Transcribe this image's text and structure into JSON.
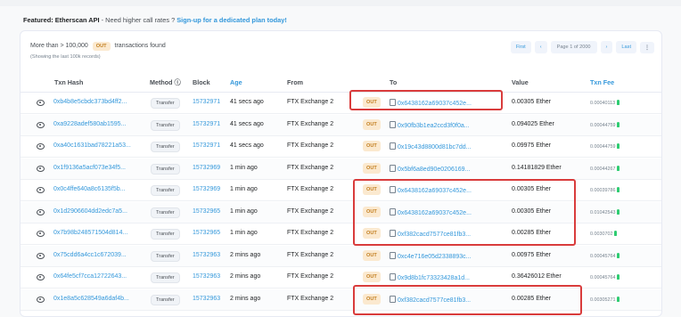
{
  "featured": {
    "label": "Featured: Etherscan API",
    "text": " - Need higher call rates ? ",
    "link": "Sign-up for a dedicated plan today!"
  },
  "summary": {
    "prefix": "More than > 100,000",
    "badge": "OUT",
    "suffix": "transactions found",
    "sub": "(Showing the last 100k records)"
  },
  "pager": {
    "first": "First",
    "prev": "‹",
    "page": "Page 1 of 2000",
    "next": "›",
    "last": "Last",
    "more": "⋮"
  },
  "columns": {
    "txn_hash": "Txn Hash",
    "method": "Method ⓘ",
    "block": "Block",
    "age": "Age",
    "from": "From",
    "to": "To",
    "value": "Value",
    "fee": "Txn Fee"
  },
  "rows": [
    {
      "hash": "0xb4b8e5cbdc373bd4ff2...",
      "method": "Transfer",
      "block": "15732971",
      "age": "41 secs ago",
      "from": "FTX Exchange 2",
      "dir": "OUT",
      "to": "0x6438162a69037c452e...",
      "value": "0.00305 Ether",
      "fee": "0.00040113"
    },
    {
      "hash": "0xa9228adef580ab1595...",
      "method": "Transfer",
      "block": "15732971",
      "age": "41 secs ago",
      "from": "FTX Exchange 2",
      "dir": "OUT",
      "to": "0x90fb3b1ea2ccd3f0f0a...",
      "value": "0.094025 Ether",
      "fee": "0.00044759"
    },
    {
      "hash": "0xa40c1631bad78221a53...",
      "method": "Transfer",
      "block": "15732971",
      "age": "41 secs ago",
      "from": "FTX Exchange 2",
      "dir": "OUT",
      "to": "0x19c43d8800d81bc7dd...",
      "value": "0.09975 Ether",
      "fee": "0.00044759"
    },
    {
      "hash": "0x1f9136a5acf073e34f5...",
      "method": "Transfer",
      "block": "15732969",
      "age": "1 min ago",
      "from": "FTX Exchange 2",
      "dir": "OUT",
      "to": "0x5bf6a8ed90e0206169...",
      "value": "0.14181829 Ether",
      "fee": "0.00044267"
    },
    {
      "hash": "0x0c4ffe640a8c6135f5b...",
      "method": "Transfer",
      "block": "15732969",
      "age": "1 min ago",
      "from": "FTX Exchange 2",
      "dir": "OUT",
      "to": "0x6438162a69037c452e...",
      "value": "0.00305 Ether",
      "fee": "0.00039786"
    },
    {
      "hash": "0x1d2906604dd2edc7a5...",
      "method": "Transfer",
      "block": "15732965",
      "age": "1 min ago",
      "from": "FTX Exchange 2",
      "dir": "OUT",
      "to": "0x6438162a69037c452e...",
      "value": "0.00305 Ether",
      "fee": "0.01042543"
    },
    {
      "hash": "0x7b98b248571504d814...",
      "method": "Transfer",
      "block": "15732965",
      "age": "1 min ago",
      "from": "FTX Exchange 2",
      "dir": "OUT",
      "to": "0xf382cacd7577ce81fb3...",
      "value": "0.00285 Ether",
      "fee": "0.0030702"
    },
    {
      "hash": "0x75cdd6a4cc1c672039...",
      "method": "Transfer",
      "block": "15732963",
      "age": "2 mins ago",
      "from": "FTX Exchange 2",
      "dir": "OUT",
      "to": "0xc4e716e05d2338893c...",
      "value": "0.00975 Ether",
      "fee": "0.00045764"
    },
    {
      "hash": "0x64fe5cf7cca12722643...",
      "method": "Transfer",
      "block": "15732963",
      "age": "2 mins ago",
      "from": "FTX Exchange 2",
      "dir": "OUT",
      "to": "0x9d8b1fc73323428a1d...",
      "value": "0.36426012 Ether",
      "fee": "0.00045764"
    },
    {
      "hash": "0x1e8a5c628549a6daf4b...",
      "method": "Transfer",
      "block": "15732963",
      "age": "2 mins ago",
      "from": "FTX Exchange 2",
      "dir": "OUT",
      "to": "0xf382cacd7577ce81fb3...",
      "value": "0.00285 Ether",
      "fee": "0.00305271"
    }
  ]
}
